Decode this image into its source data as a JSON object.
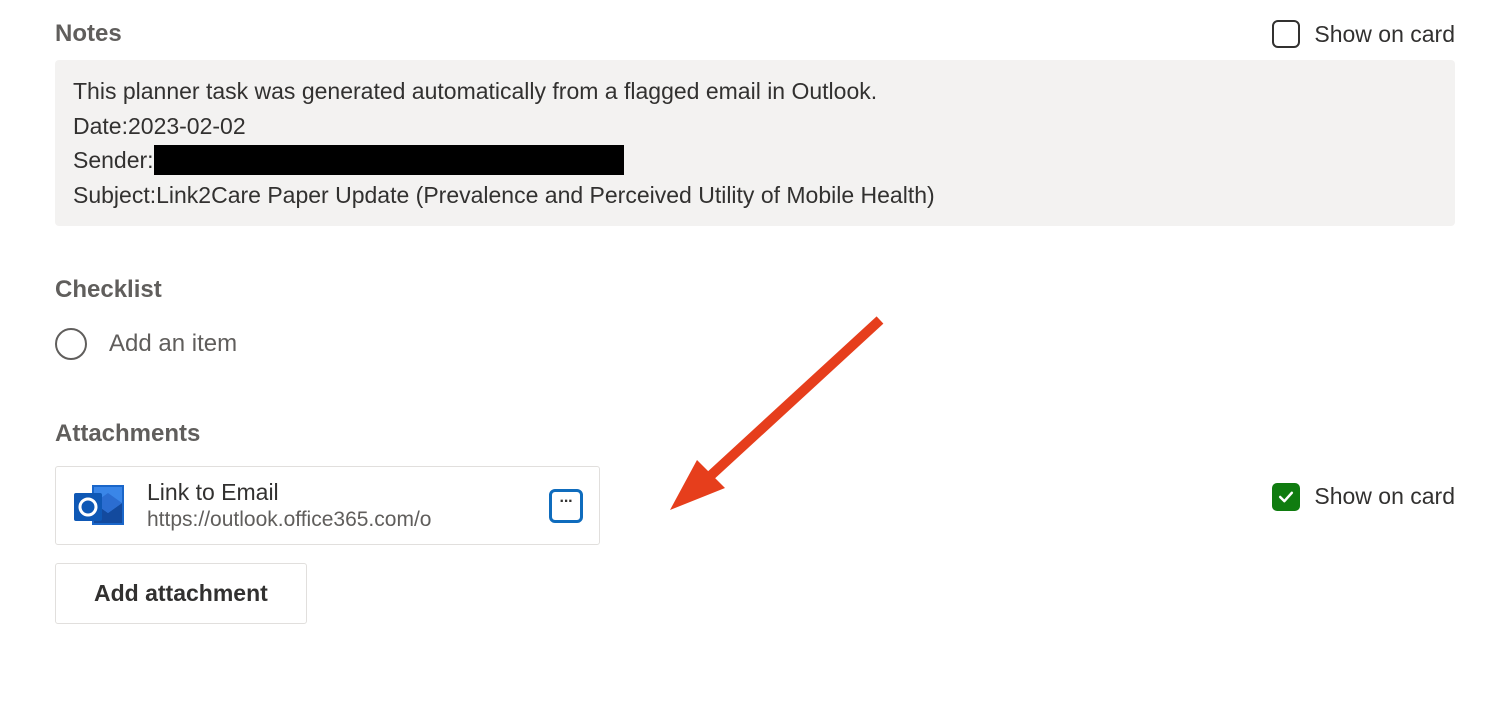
{
  "notes": {
    "title": "Notes",
    "show_on_card_label": "Show on card",
    "show_on_card_checked": false,
    "line1": "This planner task was generated automatically from a flagged email in Outlook.",
    "line2_prefix": "Date: ",
    "line2_value": "2023-02-02",
    "line3_prefix": "Sender:",
    "line4_prefix": "Subject: ",
    "line4_value": "Link2Care Paper Update (Prevalence and Perceived Utility of Mobile Health)"
  },
  "checklist": {
    "title": "Checklist",
    "add_item_placeholder": "Add an item"
  },
  "attachments": {
    "title": "Attachments",
    "show_on_card_label": "Show on card",
    "show_on_card_checked": true,
    "items": [
      {
        "title": "Link to Email",
        "url": "https://outlook.office365.com/o"
      }
    ],
    "add_button_label": "Add attachment"
  }
}
